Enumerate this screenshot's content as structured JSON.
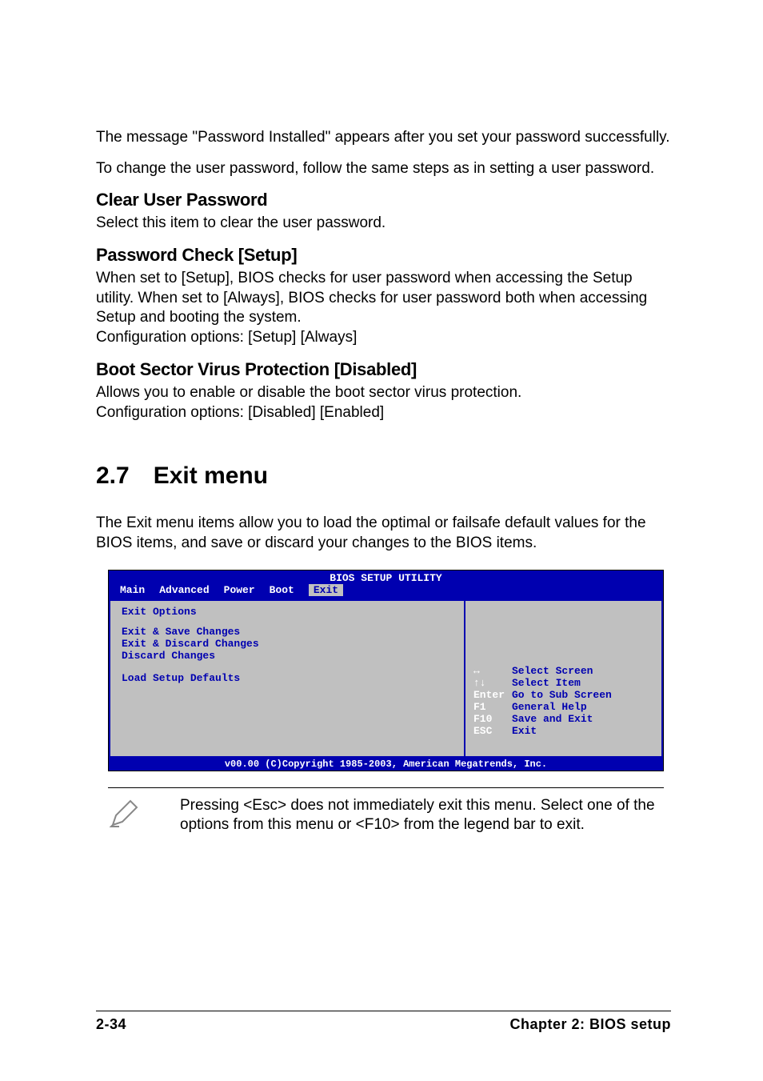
{
  "intro": {
    "p1": "The message \"Password Installed\" appears after you set your password successfully.",
    "p2": "To change the user password, follow the same steps as in setting a user password."
  },
  "sections": {
    "clear_user_password": {
      "title": "Clear User Password",
      "body": "Select this item to clear the user password."
    },
    "password_check": {
      "title": "Password Check [Setup]",
      "body1": "When set to [Setup], BIOS checks for user password when accessing the Setup utility. When set to [Always], BIOS checks for user password both when accessing Setup and booting the system.",
      "body2": "Configuration options: [Setup] [Always]"
    },
    "boot_sector": {
      "title": "Boot Sector Virus Protection [Disabled]",
      "body1": "Allows you to enable or disable the boot sector virus protection.",
      "body2": "Configuration options: [Disabled] [Enabled]"
    }
  },
  "exit_menu": {
    "num": "2.7",
    "title": "Exit menu",
    "intro": "The Exit menu items allow you to load the optimal or failsafe default values for the BIOS items, and save or discard your changes to the BIOS items."
  },
  "bios": {
    "title": "BIOS SETUP UTILITY",
    "tabs": [
      "Main",
      "Advanced",
      "Power",
      "Boot",
      "Exit"
    ],
    "selected_tab": "Exit",
    "group_title": "Exit Options",
    "items": [
      "Exit & Save Changes",
      "Exit & Discard Changes",
      "Discard Changes",
      "",
      "Load Setup Defaults"
    ],
    "legend": [
      {
        "key": "↔",
        "label": "Select Screen"
      },
      {
        "key": "↑↓",
        "label": "Select Item"
      },
      {
        "key": "Enter",
        "label": "Go to Sub Screen"
      },
      {
        "key": "F1",
        "label": "General Help"
      },
      {
        "key": "F10",
        "label": "Save and Exit"
      },
      {
        "key": "ESC",
        "label": "Exit"
      }
    ],
    "footer": "v00.00 (C)Copyright 1985-2003, American Megatrends, Inc."
  },
  "note": "Pressing <Esc> does not immediately exit this menu. Select one of the options from this menu or <F10> from the legend bar to exit.",
  "footer": {
    "left": "2-34",
    "right": "Chapter 2: BIOS setup"
  }
}
